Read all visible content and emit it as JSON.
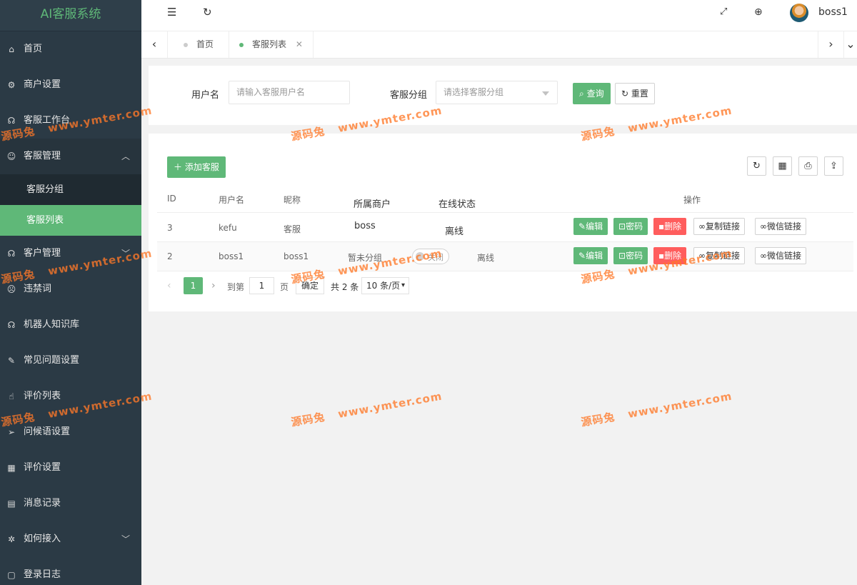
{
  "app": {
    "title": "AI客服系统"
  },
  "sidebar": {
    "items": [
      {
        "label": "首页",
        "icon": "home-icon"
      },
      {
        "label": "商户设置",
        "icon": "gear-icon"
      },
      {
        "label": "客服工作台",
        "icon": "headset-icon"
      },
      {
        "label": "客服管理",
        "icon": "user-icon",
        "expanded": true
      },
      {
        "label": "客户管理",
        "icon": "headset-icon"
      },
      {
        "label": "违禁词",
        "icon": "frown-icon"
      },
      {
        "label": "机器人知识库",
        "icon": "headset-icon"
      },
      {
        "label": "常见问题设置",
        "icon": "edit-icon"
      },
      {
        "label": "评价列表",
        "icon": "thumbs-up-icon"
      },
      {
        "label": "问候语设置",
        "icon": "send-icon"
      },
      {
        "label": "评价设置",
        "icon": "calendar-icon"
      },
      {
        "label": "消息记录",
        "icon": "note-icon"
      },
      {
        "label": "如何接入",
        "icon": "settings-icon"
      },
      {
        "label": "登录日志",
        "icon": "log-icon"
      }
    ],
    "subitems": [
      {
        "label": "客服分组",
        "active": false
      },
      {
        "label": "客服列表",
        "active": true
      }
    ]
  },
  "header": {
    "username": "boss1"
  },
  "tabs": [
    {
      "label": "首页",
      "active": false
    },
    {
      "label": "客服列表",
      "active": true,
      "closable": true
    }
  ],
  "search": {
    "username_label": "用户名",
    "username_placeholder": "请输入客服用户名",
    "group_label": "客服分组",
    "group_placeholder": "请选择客服分组",
    "query_button": "查询",
    "reset_button": "重置"
  },
  "toolbar": {
    "add_button": "添加客服"
  },
  "table": {
    "columns": [
      "ID",
      "用户名",
      "昵称",
      "所属商户",
      "在线状态",
      "操作"
    ],
    "rows": [
      {
        "id": "3",
        "username": "kefu",
        "nickname": "客服",
        "merchant": "boss",
        "status": "离线"
      },
      {
        "id": "2",
        "username": "boss1",
        "nickname": "boss1",
        "merchant": "暂未分组",
        "switch_label": "关闭",
        "status": "离线"
      }
    ],
    "actions": [
      "编辑",
      "密码",
      "删除",
      "复制链接",
      "微信链接"
    ]
  },
  "pager": {
    "current": "1",
    "goto_label": "到第",
    "goto_value": "1",
    "page_unit": "页",
    "confirm": "确定",
    "total": "共 2 条",
    "page_size": "10 条/页"
  },
  "watermark": {
    "text_cn": "源码兔",
    "text_url": "www.ymter.com"
  },
  "colors": {
    "accent": "#5fb878",
    "sidebar": "#2b3a45",
    "danger": "#ff5d5d"
  }
}
